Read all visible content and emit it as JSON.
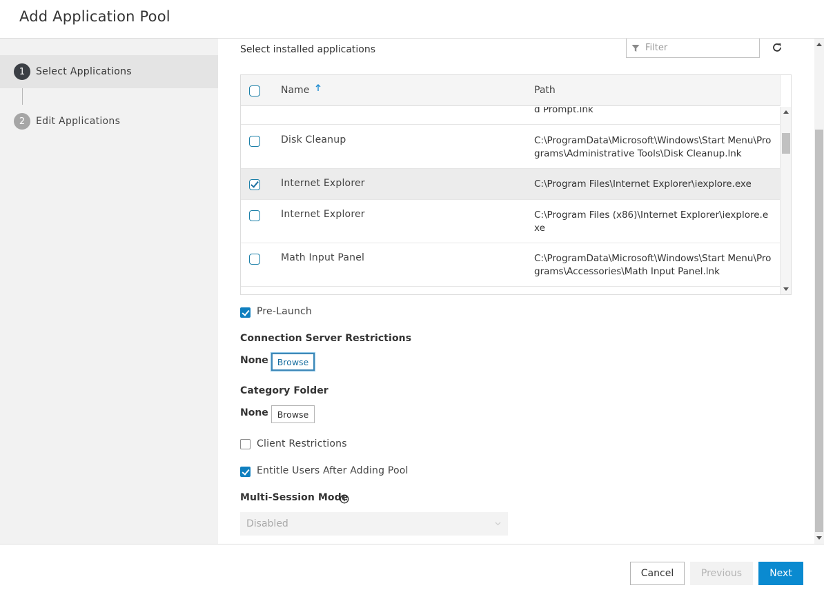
{
  "header": {
    "title": "Add Application Pool"
  },
  "wizard": {
    "steps": [
      {
        "number": "1",
        "label": "Select Applications",
        "active": true
      },
      {
        "number": "2",
        "label": "Edit Applications",
        "active": false
      }
    ]
  },
  "apps": {
    "section_title": "Select installed applications",
    "filter_placeholder": "Filter",
    "columns": {
      "name": "Name",
      "path": "Path"
    },
    "partial_row_path": "d Prompt.lnk",
    "rows": [
      {
        "name": "Disk Cleanup",
        "path": "C:\\ProgramData\\Microsoft\\Windows\\Start Menu\\Programs\\Administrative Tools\\Disk Cleanup.lnk",
        "checked": false,
        "selected": false
      },
      {
        "name": "Internet Explorer",
        "path": "C:\\Program Files\\Internet Explorer\\iexplore.exe",
        "checked": true,
        "selected": true
      },
      {
        "name": "Internet Explorer",
        "path": "C:\\Program Files (x86)\\Internet Explorer\\iexplore.exe",
        "checked": false,
        "selected": false
      },
      {
        "name": "Math Input Panel",
        "path": "C:\\ProgramData\\Microsoft\\Windows\\Start Menu\\Programs\\Accessories\\Math Input Panel.lnk",
        "checked": false,
        "selected": false
      }
    ]
  },
  "options": {
    "pre_launch": {
      "label": "Pre-Launch",
      "checked": true
    },
    "connection_server": {
      "label": "Connection Server Restrictions",
      "value": "None",
      "button": "Browse"
    },
    "category_folder": {
      "label": "Category Folder",
      "value": "None",
      "button": "Browse"
    },
    "client_restrictions": {
      "label": "Client Restrictions",
      "checked": false
    },
    "entitle_users": {
      "label": "Entitle Users After Adding Pool",
      "checked": true
    },
    "multi_session": {
      "label": "Multi-Session Mode",
      "value": "Disabled"
    }
  },
  "footer": {
    "cancel": "Cancel",
    "previous": "Previous",
    "next": "Next"
  },
  "colors": {
    "accent": "#0a8ad0",
    "checkbox_border": "#1a7fa8",
    "disabled_text": "#b5b5b5"
  }
}
